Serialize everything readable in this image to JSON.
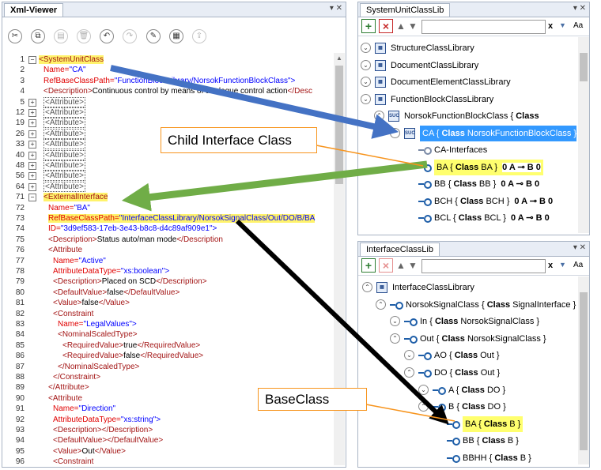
{
  "xml_viewer": {
    "title": "Xml-Viewer",
    "pin": "▾ ✕",
    "toolbar_icons": [
      "cut-icon",
      "copy-icon",
      "paste-icon",
      "delete-icon",
      "undo-icon",
      "redo-icon",
      "clean-icon",
      "save-icon",
      "export-icon"
    ],
    "lines": [
      {
        "n": "1",
        "parts": [
          {
            "t": "<SystemUnitClass",
            "c": "tg",
            "hl": true
          }
        ]
      },
      {
        "n": "2",
        "parts": [
          {
            "t": "Name=",
            "c": "at"
          },
          {
            "t": "\"CA\"",
            "c": "av"
          }
        ]
      },
      {
        "n": "3",
        "parts": [
          {
            "t": "RefBaseClassPath=",
            "c": "at"
          },
          {
            "t": "\"FunctionBlockLibrary/NorsokFunctionBlockClass\">",
            "c": "av"
          }
        ]
      },
      {
        "n": "4",
        "parts": [
          {
            "t": "<Description>",
            "c": "tg"
          },
          {
            "t": "Continuous control by me",
            "c": "bl"
          },
          {
            "t": "ans of analogue control action",
            "c": "bl"
          },
          {
            "t": "</Desc",
            "c": "tg"
          }
        ]
      },
      {
        "n": "5",
        "parts": [
          {
            "t": "<Attribute>",
            "c": "tg",
            "box": true
          }
        ]
      },
      {
        "n": "12",
        "parts": [
          {
            "t": "<Attribute>",
            "c": "tg",
            "box": true
          }
        ]
      },
      {
        "n": "19",
        "parts": [
          {
            "t": "<Attribute>",
            "c": "tg",
            "box": true
          }
        ]
      },
      {
        "n": "26",
        "parts": [
          {
            "t": "<Attribute>",
            "c": "tg",
            "box": true
          }
        ]
      },
      {
        "n": "33",
        "parts": [
          {
            "t": "<Attribute>",
            "c": "tg",
            "box": true
          }
        ]
      },
      {
        "n": "40",
        "parts": [
          {
            "t": "<Attribute>",
            "c": "tg",
            "box": true
          }
        ]
      },
      {
        "n": "48",
        "parts": [
          {
            "t": "<Attribute>",
            "c": "tg",
            "box": true
          }
        ]
      },
      {
        "n": "56",
        "parts": [
          {
            "t": "<Attribute>",
            "c": "tg",
            "box": true
          }
        ]
      },
      {
        "n": "64",
        "parts": [
          {
            "t": "<Attribute>",
            "c": "tg",
            "box": true
          }
        ]
      },
      {
        "n": "71",
        "parts": [
          {
            "t": "<ExternalInterface",
            "c": "tg",
            "hl": true
          }
        ]
      },
      {
        "n": "72",
        "parts": [
          {
            "t": "Name=",
            "c": "at"
          },
          {
            "t": "\"BA\"",
            "c": "av"
          }
        ]
      },
      {
        "n": "73",
        "parts": [
          {
            "t": "RefBaseClassPath=",
            "c": "at",
            "hl": true
          },
          {
            "t": "\"InterfaceClassLibrary/NorsokSignalClass/Out/DO/B/BA",
            "c": "av",
            "hl": true
          }
        ]
      },
      {
        "n": "74",
        "parts": [
          {
            "t": "ID=",
            "c": "at"
          },
          {
            "t": "\"3d9ef583-17eb-3e43-b8c8-d4c89af909e1\">",
            "c": "av"
          }
        ]
      },
      {
        "n": "75",
        "parts": [
          {
            "t": "<Description>",
            "c": "tg"
          },
          {
            "t": "Status auto/man mode",
            "c": "bl"
          },
          {
            "t": "</Description",
            "c": "tg"
          }
        ]
      },
      {
        "n": "76",
        "parts": [
          {
            "t": "<Attribute",
            "c": "tg"
          }
        ]
      },
      {
        "n": "77",
        "parts": [
          {
            "t": "Name=",
            "c": "at"
          },
          {
            "t": "\"Active\"",
            "c": "av"
          }
        ]
      },
      {
        "n": "78",
        "parts": [
          {
            "t": "AttributeDataType=",
            "c": "at"
          },
          {
            "t": "\"xs:boolean\">",
            "c": "av"
          }
        ]
      },
      {
        "n": "79",
        "parts": [
          {
            "t": "<Description>",
            "c": "tg"
          },
          {
            "t": "Placed on SCD",
            "c": "bl"
          },
          {
            "t": "</Description>",
            "c": "tg"
          }
        ]
      },
      {
        "n": "80",
        "parts": [
          {
            "t": "<DefaultValue>",
            "c": "tg"
          },
          {
            "t": "false",
            "c": "bl"
          },
          {
            "t": "</DefaultValue>",
            "c": "tg"
          }
        ]
      },
      {
        "n": "81",
        "parts": [
          {
            "t": "<Value>",
            "c": "tg"
          },
          {
            "t": "false",
            "c": "bl"
          },
          {
            "t": "</Value>",
            "c": "tg"
          }
        ]
      },
      {
        "n": "82",
        "parts": [
          {
            "t": "<Constraint",
            "c": "tg"
          }
        ]
      },
      {
        "n": "83",
        "parts": [
          {
            "t": "Name=",
            "c": "at"
          },
          {
            "t": "\"LegalValues\">",
            "c": "av"
          }
        ]
      },
      {
        "n": "84",
        "parts": [
          {
            "t": "<NominalScaledType>",
            "c": "tg"
          }
        ]
      },
      {
        "n": "85",
        "parts": [
          {
            "t": "<RequiredValue>",
            "c": "tg"
          },
          {
            "t": "true",
            "c": "bl"
          },
          {
            "t": "</RequiredValue>",
            "c": "tg"
          }
        ]
      },
      {
        "n": "86",
        "parts": [
          {
            "t": "<RequiredValue>",
            "c": "tg"
          },
          {
            "t": "false",
            "c": "bl"
          },
          {
            "t": "</RequiredValue>",
            "c": "tg"
          }
        ]
      },
      {
        "n": "87",
        "parts": [
          {
            "t": "</NominalScaledType>",
            "c": "tg"
          }
        ]
      },
      {
        "n": "88",
        "parts": [
          {
            "t": "</Constraint>",
            "c": "tg"
          }
        ]
      },
      {
        "n": "89",
        "parts": [
          {
            "t": "</Attribute>",
            "c": "tg"
          }
        ]
      },
      {
        "n": "90",
        "parts": [
          {
            "t": "<Attribute",
            "c": "tg"
          }
        ]
      },
      {
        "n": "91",
        "parts": [
          {
            "t": "Name=",
            "c": "at"
          },
          {
            "t": "\"Direction\"",
            "c": "av"
          }
        ]
      },
      {
        "n": "92",
        "parts": [
          {
            "t": "AttributeDataType=",
            "c": "at"
          },
          {
            "t": "\"xs:string\">",
            "c": "av"
          }
        ]
      },
      {
        "n": "93",
        "parts": [
          {
            "t": "<Description>",
            "c": "tg"
          },
          {
            "t": "</Description>",
            "c": "tg"
          }
        ]
      },
      {
        "n": "94",
        "parts": [
          {
            "t": "<DefaultValue>",
            "c": "tg"
          },
          {
            "t": "</DefaultValue>",
            "c": "tg"
          }
        ]
      },
      {
        "n": "95",
        "parts": [
          {
            "t": "<Value>",
            "c": "tg"
          },
          {
            "t": "Out",
            "c": "bl"
          },
          {
            "t": "</Value>",
            "c": "tg"
          }
        ]
      },
      {
        "n": "96",
        "parts": [
          {
            "t": "<Constraint",
            "c": "tg"
          }
        ]
      }
    ]
  },
  "system_unit_lib": {
    "title": "SystemUnitClassLib",
    "pin": "▾ ✕",
    "search_clear": "x",
    "search_options": "Aa",
    "rows": [
      {
        "label": "StructureClassLibrary",
        "kind": "lib",
        "exp": "v"
      },
      {
        "label": "DocumentClassLibrary",
        "kind": "lib",
        "exp": "v"
      },
      {
        "label": "DocumentElementClassLibrary",
        "kind": "lib",
        "exp": "v"
      },
      {
        "label": "FunctionBlockClassLibrary",
        "kind": "lib",
        "exp": "v"
      },
      {
        "label": "NorsokFunctionBlockClass",
        "pre": " { ",
        "bold": "Class",
        "post": "",
        "kind": "cls",
        "exp": "^"
      },
      {
        "label": "CA",
        "pre": " { ",
        "bold": "Class",
        "post": " NorsokFunctionBlockClass }",
        "kind": "cls",
        "exp": "^",
        "selected": true
      },
      {
        "label": "CA-Interfaces",
        "kind": "grp",
        "exp": ""
      },
      {
        "label": "BA",
        "pre": " { ",
        "bold": "Class",
        "post": " BA }",
        "extra": "0 A ⊸ B 0",
        "kind": "ifc",
        "exp": "",
        "yellow": true
      },
      {
        "label": "BB",
        "pre": " { ",
        "bold": "Class",
        "post": " BB }",
        "extra": "0 A ⊸ B 0",
        "kind": "ifc",
        "exp": ""
      },
      {
        "label": "BCH",
        "pre": " { ",
        "bold": "Class",
        "post": " BCH }",
        "extra": "0 A ⊸ B 0",
        "kind": "ifc",
        "exp": ""
      },
      {
        "label": "BCL",
        "pre": " { ",
        "bold": "Class",
        "post": " BCL }",
        "extra": "0 A ⊸ B 0",
        "kind": "ifc",
        "exp": ""
      }
    ]
  },
  "interface_lib": {
    "title": "InterfaceClassLib",
    "pin": "▾ ✕",
    "search_clear": "x",
    "search_options": "Aa",
    "rows": [
      {
        "label": "InterfaceClassLibrary",
        "kind": "lib",
        "exp": "^"
      },
      {
        "label": "NorsokSignalClass",
        "pre": " { ",
        "bold": "Class",
        "post": " SignalInterface }",
        "kind": "ifc",
        "exp": "^"
      },
      {
        "label": "In",
        "pre": " { ",
        "bold": "Class",
        "post": " NorsokSignalClass }",
        "kind": "ifc",
        "exp": "v"
      },
      {
        "label": "Out",
        "pre": " { ",
        "bold": "Class",
        "post": " NorsokSignalClass }",
        "kind": "ifc",
        "exp": "^"
      },
      {
        "label": "AO",
        "pre": " { ",
        "bold": "Class",
        "post": " Out }",
        "kind": "ifc",
        "exp": "v"
      },
      {
        "label": "DO",
        "pre": " { ",
        "bold": "Class",
        "post": " Out }",
        "kind": "ifc",
        "exp": "^"
      },
      {
        "label": "A",
        "pre": " { ",
        "bold": "Class",
        "post": " DO }",
        "kind": "ifc",
        "exp": "v"
      },
      {
        "label": "B",
        "pre": " { ",
        "bold": "Class",
        "post": " DO }",
        "kind": "ifc",
        "exp": "^"
      },
      {
        "label": "BA",
        "pre": " { ",
        "bold": "Class",
        "post": " B }",
        "kind": "ifc",
        "exp": "",
        "yellow": true
      },
      {
        "label": "BB",
        "pre": " { ",
        "bold": "Class",
        "post": " B }",
        "kind": "ifc",
        "exp": ""
      },
      {
        "label": "BBHH",
        "pre": " { ",
        "bold": "Class",
        "post": " B }",
        "kind": "ifc",
        "exp": ""
      }
    ]
  },
  "callouts": {
    "child_interface": "Child Interface Class",
    "base_class": "BaseClass"
  },
  "colors": {
    "arrow_blue": "#4472c4",
    "arrow_green": "#70ad47",
    "arrow_black": "#000000",
    "callout_border": "#f7941d",
    "selection": "#3399ff",
    "highlight": "#ffff6e"
  }
}
